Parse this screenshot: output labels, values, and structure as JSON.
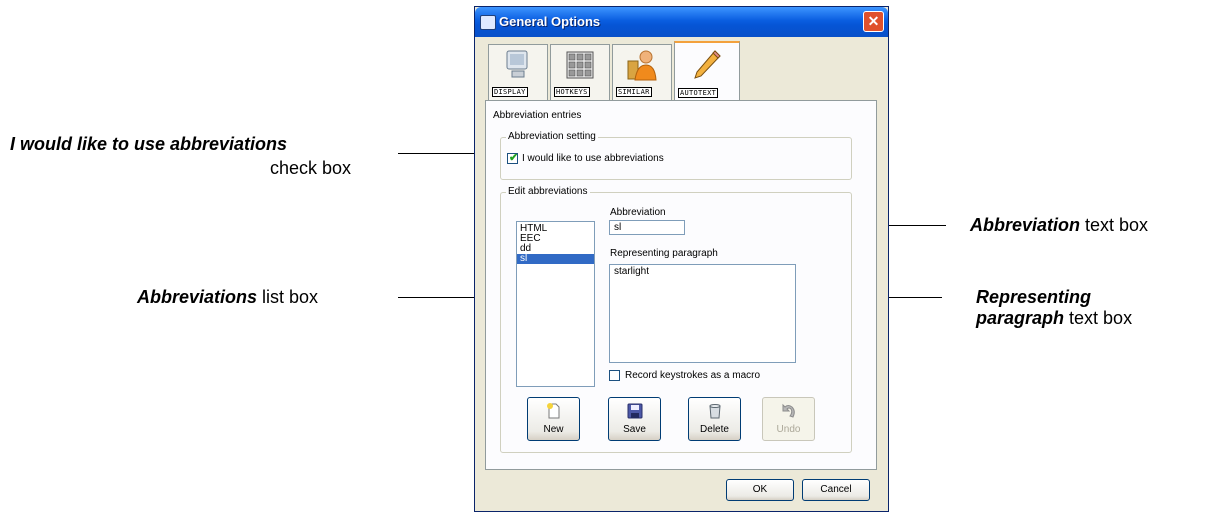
{
  "annotations": {
    "abbrev_checkbox": {
      "bold": "I would like to use abbreviations",
      "rest": "check box"
    },
    "abbrev_listbox": {
      "bold": "Abbreviations",
      "rest": " list box"
    },
    "abbrev_textbox": {
      "bold": "Abbreviation",
      "rest": " text box"
    },
    "repr_textbox": {
      "bold_line1": "Representing",
      "bold_line2": "paragraph",
      "rest": " text box"
    }
  },
  "dialog": {
    "title": "General Options",
    "close_glyph": "✕",
    "tabs": [
      {
        "label": "DISPLAY",
        "icon": "monitor-icon"
      },
      {
        "label": "HOTKEYS",
        "icon": "keyboard-icon"
      },
      {
        "label": "SIMILAR",
        "icon": "person-icon"
      },
      {
        "label": "AUTOTEXT",
        "icon": "pencil-icon",
        "active": true
      }
    ],
    "group_entries": "Abbreviation entries",
    "group_setting": "Abbreviation setting",
    "checkbox_label": "I would like to use abbreviations",
    "checkbox_checked": true,
    "group_edit": "Edit abbreviations",
    "abbreviation_label": "Abbreviation",
    "abbreviation_value": "sl",
    "list_items": [
      "HTML",
      "EEC",
      "dd",
      "sl"
    ],
    "selected_item": "sl",
    "repr_label": "Representing paragraph",
    "repr_value": "starlight",
    "macro_label": "Record keystrokes as a macro",
    "macro_checked": false,
    "buttons": {
      "new": "New",
      "save": "Save",
      "delete": "Delete",
      "undo": "Undo"
    },
    "ok": "OK",
    "cancel": "Cancel"
  }
}
